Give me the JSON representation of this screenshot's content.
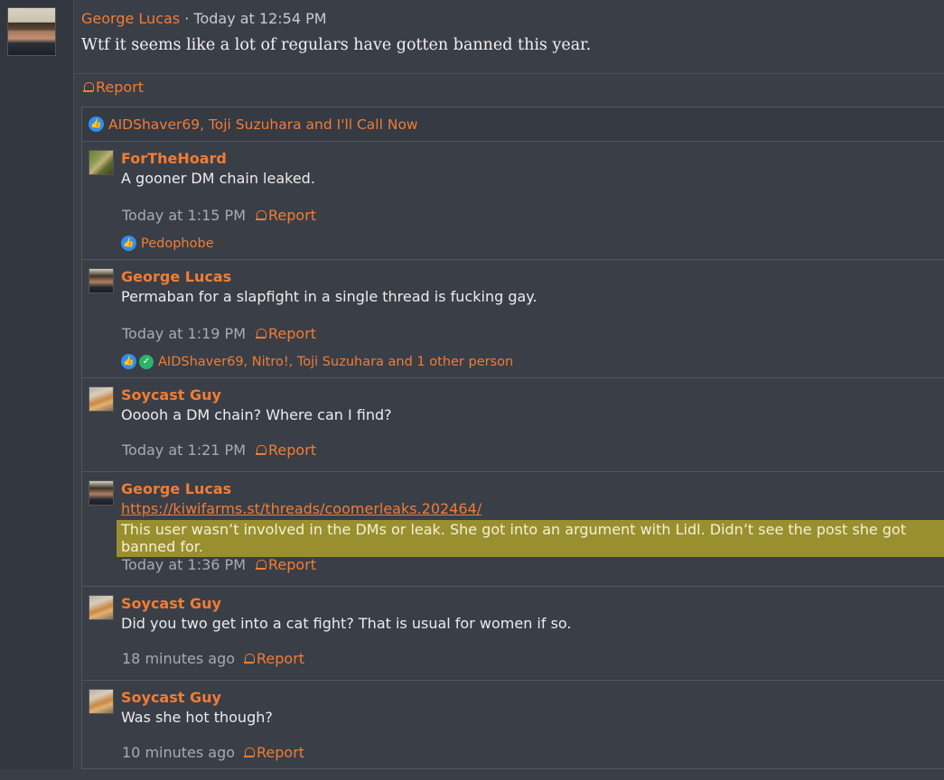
{
  "op": {
    "author": "George Lucas",
    "separator": " · ",
    "timestamp": "Today at 12:54 PM",
    "text": "Wtf it seems like a lot of regulars have gotten banned this year.",
    "report_label": "Report"
  },
  "op_reactions": "AIDShaver69, Toji Suzuhara and I'll Call Now",
  "replies": [
    {
      "author": "ForTheHoard",
      "text": "A gooner DM chain leaked.",
      "time": "Today at 1:15 PM",
      "report": "Report",
      "reactions": "Pedophobe"
    },
    {
      "author": "George Lucas",
      "text": "Permaban for a slapfight in a single thread is fucking gay.",
      "time": "Today at 1:19 PM",
      "report": "Report",
      "reactions": "AIDShaver69, Nitro!, Toji Suzuhara and 1 other person"
    },
    {
      "author": "Soycast Guy",
      "text": "Ooooh a DM chain? Where can I find?",
      "time": "Today at 1:21 PM",
      "report": "Report"
    },
    {
      "author": "George Lucas",
      "link": "https://kiwifarms.st/threads/coomerleaks.202464/",
      "highlight": "This user wasn’t involved in the DMs or leak. She got into an argument with Lidl. Didn’t see the post she got banned for.",
      "time": "Today at 1:36 PM",
      "report": "Report"
    },
    {
      "author": "Soycast Guy",
      "text": "Did you two get into a cat fight? That is usual for women if so.",
      "time": "18 minutes ago",
      "report": "Report"
    },
    {
      "author": "Soycast Guy",
      "text": "Was she hot though?",
      "time": "10 minutes ago",
      "report": "Report"
    }
  ],
  "colors": {
    "accent": "#f07d35",
    "background": "#3a3e47",
    "highlight": "#9a8f2e",
    "like_blue": "#2f8ff0"
  }
}
